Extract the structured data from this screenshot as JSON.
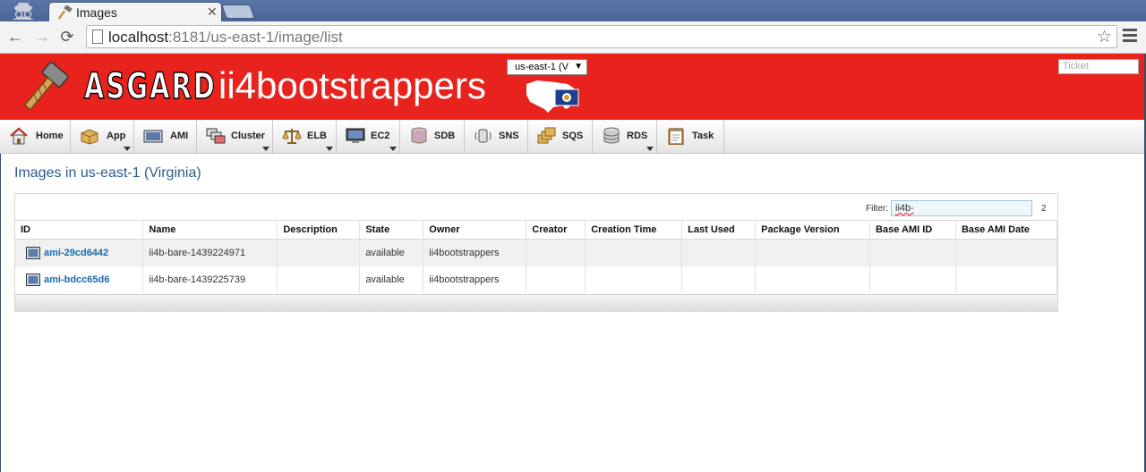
{
  "browser": {
    "tab_title": "Images",
    "url_host": "localhost",
    "url_rest": ":8181/us-east-1/image/list"
  },
  "header": {
    "logo": "ASGARD",
    "app_name": "ii4bootstrappers",
    "region_select": "us-east-1 (V",
    "ticket_placeholder": "Ticket",
    "accent": "#e8231e"
  },
  "menu": {
    "items": [
      {
        "label": "Home",
        "icon": "home-icon"
      },
      {
        "label": "App",
        "icon": "box-icon"
      },
      {
        "label": "AMI",
        "icon": "ami-icon"
      },
      {
        "label": "Cluster",
        "icon": "cluster-icon"
      },
      {
        "label": "ELB",
        "icon": "scales-icon"
      },
      {
        "label": "EC2",
        "icon": "monitor-icon"
      },
      {
        "label": "SDB",
        "icon": "database-icon"
      },
      {
        "label": "SNS",
        "icon": "sns-icon"
      },
      {
        "label": "SQS",
        "icon": "queue-icon"
      },
      {
        "label": "RDS",
        "icon": "rds-icon"
      },
      {
        "label": "Task",
        "icon": "clipboard-icon"
      }
    ]
  },
  "main": {
    "title": "Images in us-east-1 (Virginia)",
    "filter_label": "Filter:",
    "filter_value": "ii4b-",
    "filter_count": "2",
    "columns": [
      "ID",
      "Name",
      "Description",
      "State",
      "Owner",
      "Creator",
      "Creation Time",
      "Last Used",
      "Package Version",
      "Base AMI ID",
      "Base AMI Date"
    ],
    "rows": [
      {
        "id": "ami-29cd6442",
        "name": "ii4b-bare-1439224971",
        "description": "",
        "state": "available",
        "owner": "ii4bootstrappers",
        "creator": "",
        "creation_time": "",
        "last_used": "",
        "package_version": "",
        "base_ami_id": "",
        "base_ami_date": ""
      },
      {
        "id": "ami-bdcc65d6",
        "name": "ii4b-bare-1439225739",
        "description": "",
        "state": "available",
        "owner": "ii4bootstrappers",
        "creator": "",
        "creation_time": "",
        "last_used": "",
        "package_version": "",
        "base_ami_id": "",
        "base_ami_date": ""
      }
    ]
  }
}
